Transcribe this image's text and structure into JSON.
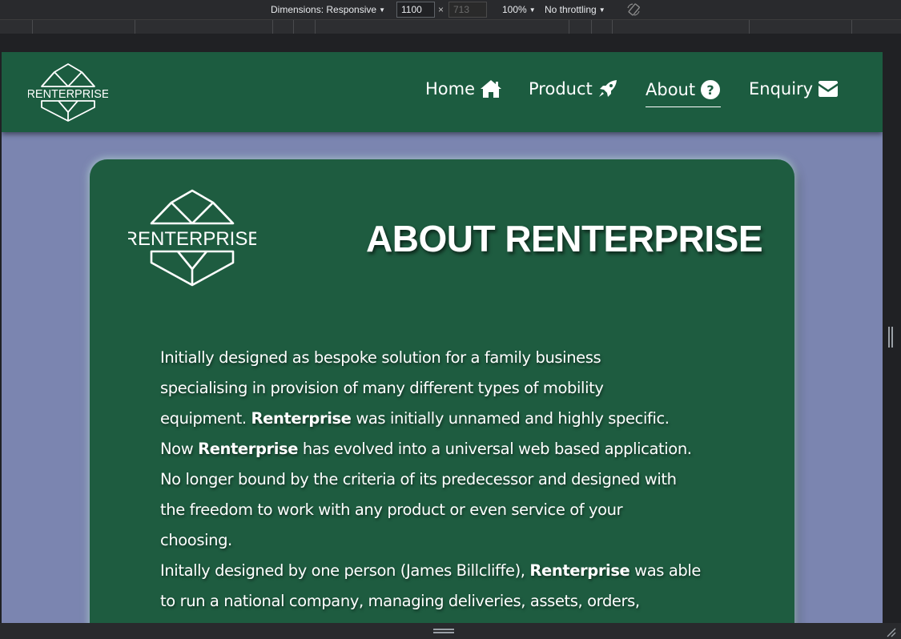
{
  "devtools": {
    "dimensions_label": "Dimensions: Responsive",
    "width_value": "1100",
    "height_value": "713",
    "zoom_label": "100%",
    "throttle_label": "No throttling"
  },
  "nav": {
    "logo_text": "RENTERPRISE",
    "links": [
      {
        "label": "Home",
        "icon": "home-icon"
      },
      {
        "label": "Product",
        "icon": "rocket-icon"
      },
      {
        "label": "About",
        "icon": "question-circle-icon",
        "active": true
      },
      {
        "label": "Enquiry",
        "icon": "envelope-icon"
      }
    ]
  },
  "about": {
    "logo_text": "RENTERPRISE",
    "title": "ABOUT RENTERPRISE",
    "brand": "Renterprise",
    "lines": {
      "l1": "Initially designed as bespoke solution for a family business",
      "l2": "specialising in provision of many different types of mobility",
      "l3a": "equipment. ",
      "l3b": " was initially unnamed and highly specific.",
      "l4a": "Now ",
      "l4b": " has evolved into a universal web based application.",
      "l5": "No longer bound by the criteria of its predecessor and designed with",
      "l6": "the freedom to work with any product or even service of your",
      "l7": "choosing.",
      "l8a": "Initally designed by one person (James Billcliffe), ",
      "l8b": " was able",
      "l9": "to run a national company, managing deliveries, assets, orders,"
    }
  },
  "colors": {
    "nav_bg": "#1c5c40",
    "page_bg": "#7b85b0",
    "card_bg": "#1e5c40",
    "text": "#ffffff"
  }
}
